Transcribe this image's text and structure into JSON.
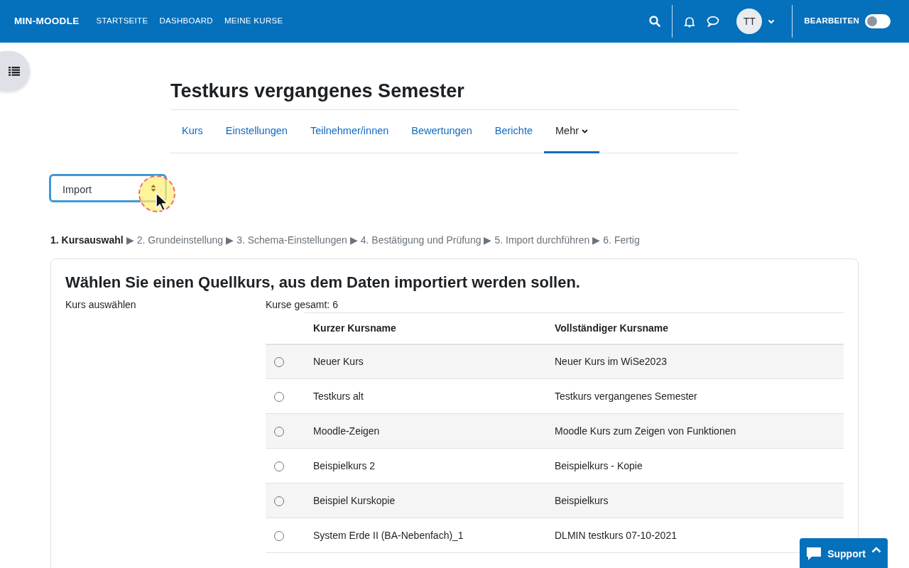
{
  "navbar": {
    "brand": "MIN-MOODLE",
    "links": [
      "STARTSEITE",
      "DASHBOARD",
      "MEINE KURSE"
    ],
    "avatar": "TT",
    "edit_label": "BEARBEITEN",
    "edit_on": false
  },
  "course_title": "Testkurs vergangenes Semester",
  "tabs": [
    {
      "label": "Kurs",
      "selected": false
    },
    {
      "label": "Einstellungen",
      "selected": false
    },
    {
      "label": "Teilnehmer/innen",
      "selected": false
    },
    {
      "label": "Bewertungen",
      "selected": false
    },
    {
      "label": "Berichte",
      "selected": false
    },
    {
      "label": "Mehr",
      "selected": true,
      "dropdown": true
    }
  ],
  "action_select": {
    "value": "Import"
  },
  "steps": [
    {
      "label": "1. Kursauswahl",
      "selected": true
    },
    {
      "label": "2. Grundeinstellung",
      "selected": false
    },
    {
      "label": "3. Schema-Einstellungen",
      "selected": false
    },
    {
      "label": "4. Bestätigung und Prüfung",
      "selected": false
    },
    {
      "label": "5. Import durchführen",
      "selected": false
    },
    {
      "label": "6. Fertig",
      "selected": false
    }
  ],
  "step_separator": "▶",
  "card": {
    "heading": "Wählen Sie einen Quellkurs, aus dem Daten importiert werden sollen.",
    "field_label": "Kurs auswählen",
    "total": "Kurse gesamt: 6",
    "table": {
      "columns": [
        "Kurzer Kursname",
        "Vollständiger Kursname"
      ],
      "rows": [
        {
          "short": "Neuer Kurs",
          "full": "Neuer Kurs im WiSe2023",
          "selected": false
        },
        {
          "short": "Testkurs alt",
          "full": "Testkurs vergangenes Semester",
          "selected": false
        },
        {
          "short": "Moodle-Zeigen",
          "full": "Moodle Kurs zum Zeigen von Funktionen",
          "selected": false
        },
        {
          "short": "Beispielkurs 2",
          "full": "Beispielkurs - Kopie",
          "selected": false
        },
        {
          "short": "Beispiel Kurskopie",
          "full": "Beispielkurs",
          "selected": false
        },
        {
          "short": "System Erde II (BA-Nebenfach)_1",
          "full": "DLMIN testkurs 07-10-2021",
          "selected": false
        }
      ]
    }
  },
  "support_button": "Support"
}
